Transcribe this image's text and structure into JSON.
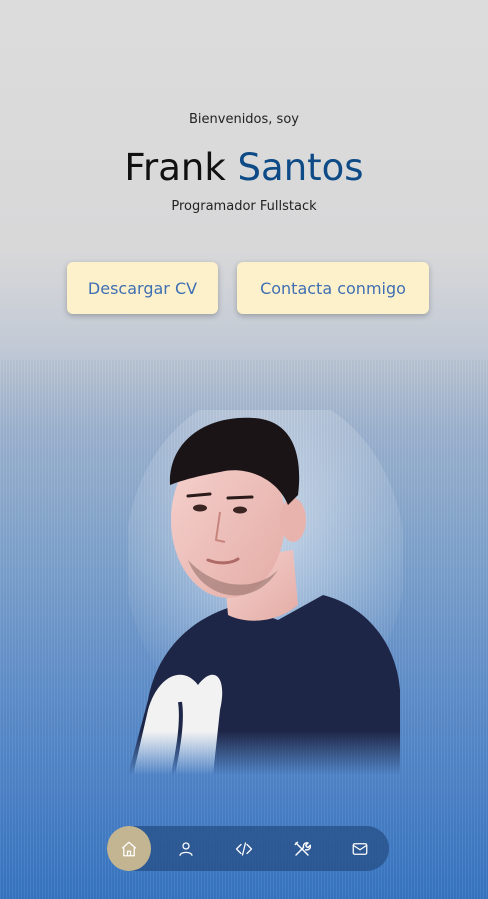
{
  "hero": {
    "greeting": "Bienvenidos, soy",
    "first_name": "Frank",
    "last_name": "Santos",
    "role": "Programador Fullstack"
  },
  "buttons": {
    "download_cv": "Descargar CV",
    "contact": "Contacta conmigo"
  },
  "nav": {
    "items": [
      {
        "icon": "home-icon",
        "active": true
      },
      {
        "icon": "user-icon",
        "active": false
      },
      {
        "icon": "code-icon",
        "active": false
      },
      {
        "icon": "tools-icon",
        "active": false
      },
      {
        "icon": "mail-icon",
        "active": false
      }
    ]
  },
  "colors": {
    "accent": "#0d4a86",
    "button_bg": "#fdf1cb",
    "button_text": "#3f6fb3",
    "nav_active": "#c3b592"
  }
}
